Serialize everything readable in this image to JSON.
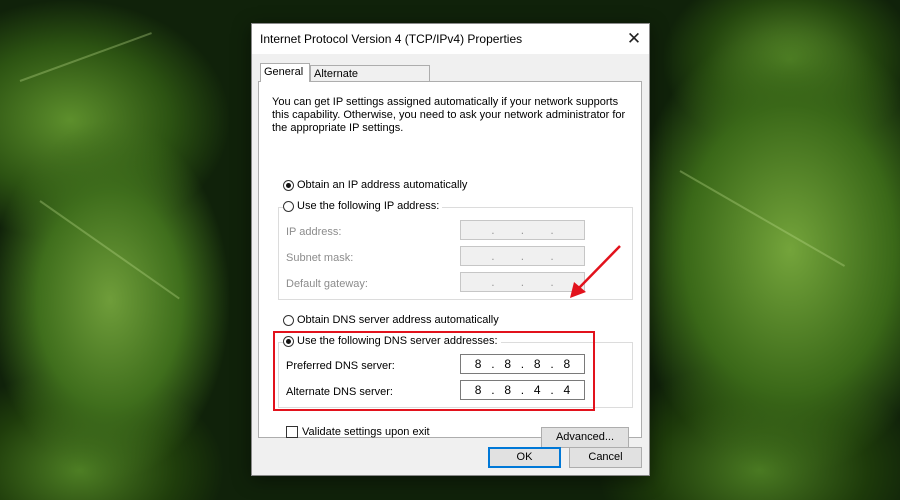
{
  "dialog": {
    "title": "Internet Protocol Version 4 (TCP/IPv4) Properties",
    "close_glyph": "✕"
  },
  "tabs": [
    {
      "label": "General",
      "active": true
    },
    {
      "label": "Alternate Configuration",
      "active": false
    }
  ],
  "intro_text": "You can get IP settings assigned automatically if your network supports this capability. Otherwise, you need to ask your network administrator for the appropriate IP settings.",
  "ip": {
    "auto_label": "Obtain an IP address automatically",
    "auto_selected": true,
    "manual_label": "Use the following IP address:",
    "manual_selected": false,
    "fields": [
      {
        "label": "IP address:",
        "octets": [
          "",
          "",
          "",
          ""
        ],
        "enabled": false
      },
      {
        "label": "Subnet mask:",
        "octets": [
          "",
          "",
          "",
          ""
        ],
        "enabled": false
      },
      {
        "label": "Default gateway:",
        "octets": [
          "",
          "",
          "",
          ""
        ],
        "enabled": false
      }
    ]
  },
  "dns": {
    "auto_label": "Obtain DNS server address automatically",
    "auto_selected": false,
    "manual_label": "Use the following DNS server addresses:",
    "manual_selected": true,
    "preferred": {
      "label": "Preferred DNS server:",
      "octets": [
        "8",
        "8",
        "8",
        "8"
      ]
    },
    "alternate": {
      "label": "Alternate DNS server:",
      "octets": [
        "8",
        "8",
        "4",
        "4"
      ]
    }
  },
  "validate": {
    "label": "Validate settings upon exit",
    "checked": false
  },
  "buttons": {
    "advanced": "Advanced...",
    "ok": "OK",
    "cancel": "Cancel"
  },
  "annotation_color": "#e2121c"
}
